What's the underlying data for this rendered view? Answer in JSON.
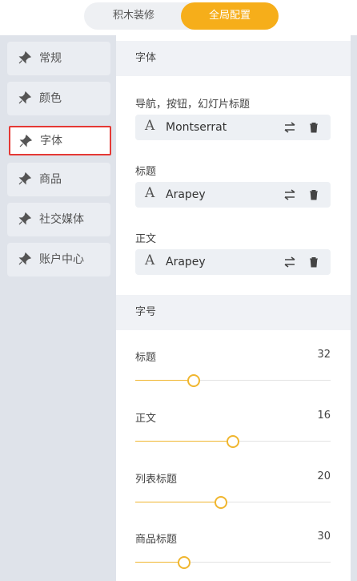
{
  "tabs": {
    "left": "积木装修",
    "right": "全局配置"
  },
  "sidebar": {
    "items": [
      {
        "label": "常规"
      },
      {
        "label": "颜色"
      },
      {
        "label": "字体"
      },
      {
        "label": "商品"
      },
      {
        "label": "社交媒体"
      },
      {
        "label": "账户中心"
      }
    ],
    "active_index": 2
  },
  "fonts": {
    "heading": "字体",
    "rows": [
      {
        "label": "导航，按钮，幻灯片标题",
        "font": "Montserrat"
      },
      {
        "label": "标题",
        "font": "Arapey"
      },
      {
        "label": "正文",
        "font": "Arapey"
      }
    ],
    "glyph": "A"
  },
  "sizes": {
    "heading": "字号",
    "items": [
      {
        "label": "标题",
        "value": "32",
        "level": 0.3
      },
      {
        "label": "正文",
        "value": "16",
        "level": 0.5
      },
      {
        "label": "列表标题",
        "value": "20",
        "level": 0.44
      },
      {
        "label": "商品标题",
        "value": "30",
        "level": 0.25
      }
    ]
  },
  "colors": {
    "accent": "#f6ae1a",
    "active_border": "#e53935",
    "sidebar_bg": "#dfe3ea"
  },
  "icons": {
    "pin": "pin-icon",
    "swap": "swap-icon",
    "trash": "trash-icon"
  }
}
